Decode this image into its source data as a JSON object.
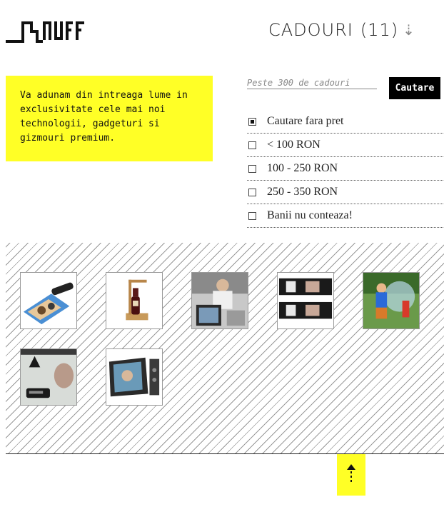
{
  "brand": {
    "logo_text": "SMUFF"
  },
  "header": {
    "title": "CADOURI",
    "count": "(11)",
    "sort_icon": "down-arrow-icon"
  },
  "intro": {
    "text": "Va adunam din intreaga lume in exclusivitate cele mai noi technologii, gadgeturi si gizmouri premium."
  },
  "search": {
    "placeholder": "Peste 300 de cadouri",
    "button_label": "Cautare"
  },
  "filters": [
    {
      "label": "Cautare fara pret",
      "checked": true
    },
    {
      "label": "< 100 RON",
      "checked": false
    },
    {
      "label": "100 - 250 RON",
      "checked": false
    },
    {
      "label": "250 - 350 RON",
      "checked": false
    },
    {
      "label": "Banii nu conteaza!",
      "checked": false
    }
  ],
  "products": [
    {
      "name": "scanner"
    },
    {
      "name": "wine-puzzle"
    },
    {
      "name": "photo-gadget"
    },
    {
      "name": "photo-frames"
    },
    {
      "name": "bubble-toy"
    },
    {
      "name": "shower-gadget"
    },
    {
      "name": "digital-frame"
    }
  ],
  "footer": {
    "back_to_top_icon": "up-arrow-icon"
  },
  "colors": {
    "accent": "#ffff26",
    "button": "#000000"
  }
}
